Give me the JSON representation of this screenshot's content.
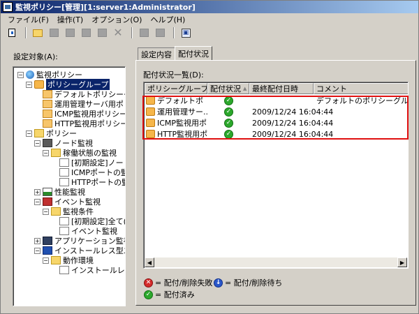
{
  "window": {
    "title": "監視ポリシー[管理][1:server1:Administrator]"
  },
  "menu": {
    "items": [
      "ファイル(F)",
      "操作(T)",
      "オプション(O)",
      "ヘルプ(H)"
    ]
  },
  "icons": {
    "toolbar": [
      "open-icon",
      "new-icon",
      "copy-icon",
      "edit-icon",
      "cut-icon",
      "paste-icon",
      "delete-icon",
      "import-icon",
      "export-icon",
      "find-icon"
    ]
  },
  "left": {
    "label": "設定対象(A):",
    "tree": [
      {
        "label": "監視ポリシー",
        "icon": "globe-icon"
      },
      {
        "label": "ポリシーグループ",
        "icon": "group-icon",
        "selected": true
      },
      {
        "label": "デフォルトポリシーグル",
        "icon": "policy-icon"
      },
      {
        "label": "運用管理サーバ用ポリシ",
        "icon": "policy-icon"
      },
      {
        "label": "ICMP監視用ポリシーグル",
        "icon": "policy-icon"
      },
      {
        "label": "HTTP監視用ポリシーグル",
        "icon": "policy-icon"
      },
      {
        "label": "ポリシー",
        "icon": "folder-icon"
      },
      {
        "label": "ノード監視",
        "icon": "node-icon"
      },
      {
        "label": "稼働状態の監視",
        "icon": "folder-icon"
      },
      {
        "label": "[初期設定]ノー",
        "icon": "doc-icon"
      },
      {
        "label": "ICMPポートの監",
        "icon": "doc-icon"
      },
      {
        "label": "HTTPポートの監",
        "icon": "doc-icon"
      },
      {
        "label": "性能監視",
        "icon": "chart-icon"
      },
      {
        "label": "イベント監視",
        "icon": "event-icon"
      },
      {
        "label": "監視条件",
        "icon": "folder-icon"
      },
      {
        "label": "[初期設定]全て(",
        "icon": "doc-icon"
      },
      {
        "label": "イベント監視",
        "icon": "doc-icon"
      },
      {
        "label": "アプリケーション監視",
        "icon": "app-icon"
      },
      {
        "label": "インストールレス型エ",
        "icon": "install-icon"
      },
      {
        "label": "動作環境",
        "icon": "folder-icon"
      },
      {
        "label": "インストールレ",
        "icon": "doc-icon"
      }
    ]
  },
  "tabs": [
    "設定内容",
    "配付状況"
  ],
  "main": {
    "list_label": "配付状況一覧(D):",
    "columns": [
      "ポリシーグループ名",
      "配付状況",
      "最終配付日時",
      "コメント"
    ],
    "rows": [
      {
        "name": "デフォルトポ",
        "status": "ok",
        "date": "",
        "comment": "デフォルトのポリシーグループ"
      },
      {
        "name": "運用管理サー...",
        "status": "ok",
        "date": "2009/12/24 16:04:44",
        "comment": ""
      },
      {
        "name": "ICMP監視用ポ...",
        "status": "ok",
        "date": "2009/12/24 16:04:44",
        "comment": ""
      },
      {
        "name": "HTTP監視用ポ...",
        "status": "ok",
        "date": "2009/12/24 16:04:44",
        "comment": ""
      }
    ]
  },
  "legend": {
    "failed": "= 配付/削除失敗",
    "waiting": "= 配付/削除待ち",
    "done": "= 配付済み"
  },
  "colors": {
    "highlight": "#e01010",
    "selected": "#0a246a",
    "ok": "#2ca82c",
    "failed": "#d42b2b",
    "waiting": "#2a57c9"
  }
}
